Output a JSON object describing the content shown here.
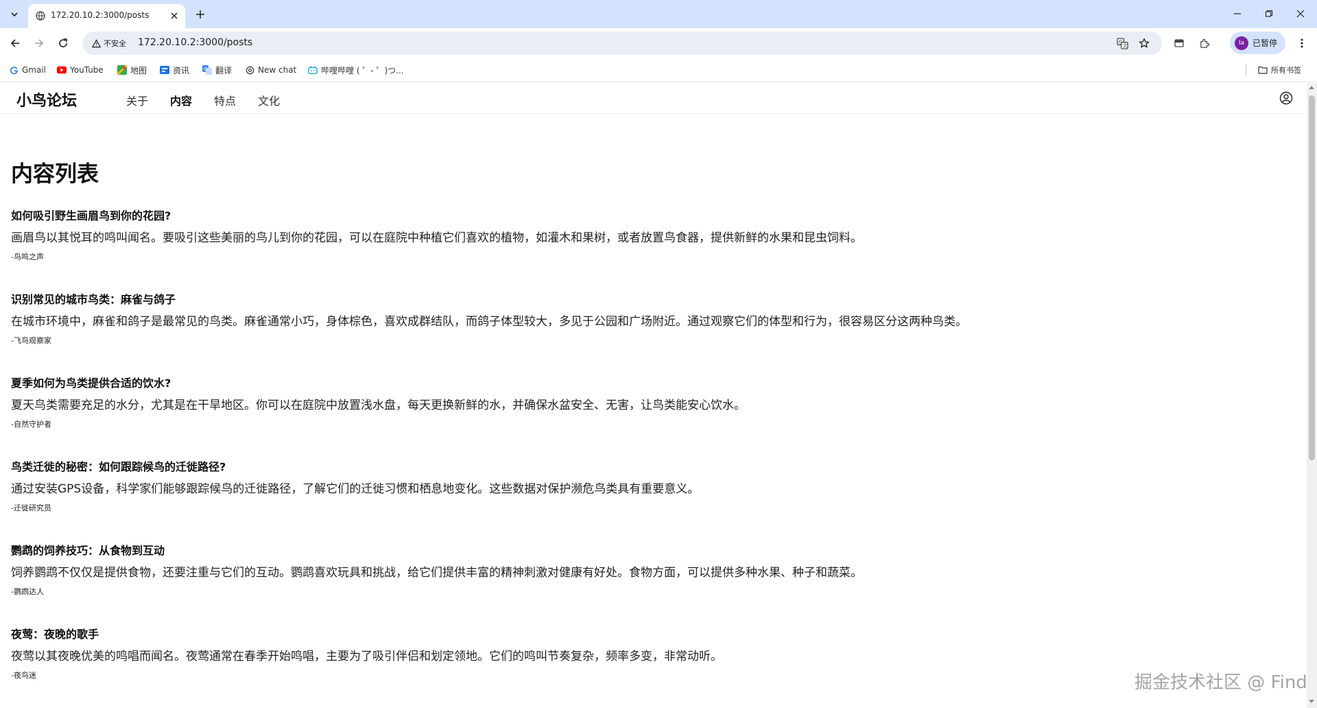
{
  "browser": {
    "tab": {
      "title": "172.20.10.2:3000/posts"
    },
    "address_bar": {
      "security_label": "不安全",
      "url": "172.20.10.2:3000/posts"
    },
    "profile": {
      "initials": "la",
      "label": "已暂停"
    },
    "bookmarks": [
      {
        "label": "Gmail",
        "icon": "gmail-icon"
      },
      {
        "label": "YouTube",
        "icon": "youtube-icon"
      },
      {
        "label": "地图",
        "icon": "maps-icon"
      },
      {
        "label": "资讯",
        "icon": "news-icon"
      },
      {
        "label": "翻译",
        "icon": "translate-icon"
      },
      {
        "label": "New chat",
        "icon": "chat-icon"
      },
      {
        "label": "哔哩哔哩 ( ゜- ゜)つ...",
        "icon": "bilibili-icon"
      }
    ],
    "all_bookmarks_label": "所有书签"
  },
  "site": {
    "brand": "小鸟论坛",
    "nav": [
      {
        "label": "关于",
        "active": false
      },
      {
        "label": "内容",
        "active": true
      },
      {
        "label": "特点",
        "active": false
      },
      {
        "label": "文化",
        "active": false
      }
    ]
  },
  "page": {
    "title": "内容列表",
    "posts": [
      {
        "title": "如何吸引野生画眉鸟到你的花园?",
        "body": "画眉鸟以其悦耳的鸣叫闻名。要吸引这些美丽的鸟儿到你的花园，可以在庭院中种植它们喜欢的植物，如灌木和果树，或者放置鸟食器，提供新鲜的水果和昆虫饲料。",
        "author": "-鸟鸣之声"
      },
      {
        "title": "识别常见的城市鸟类：麻雀与鸽子",
        "body": "在城市环境中，麻雀和鸽子是最常见的鸟类。麻雀通常小巧，身体棕色，喜欢成群结队，而鸽子体型较大，多见于公园和广场附近。通过观察它们的体型和行为，很容易区分这两种鸟类。",
        "author": "-飞鸟观察家"
      },
      {
        "title": "夏季如何为鸟类提供合适的饮水?",
        "body": "夏天鸟类需要充足的水分，尤其是在干旱地区。你可以在庭院中放置浅水盘，每天更换新鲜的水，并确保水盆安全、无害，让鸟类能安心饮水。",
        "author": "-自然守护者"
      },
      {
        "title": "鸟类迁徙的秘密：如何跟踪候鸟的迁徙路径?",
        "body": "通过安装GPS设备，科学家们能够跟踪候鸟的迁徙路径，了解它们的迁徙习惯和栖息地变化。这些数据对保护濒危鸟类具有重要意义。",
        "author": "-迁徙研究员"
      },
      {
        "title": "鹦鹉的饲养技巧：从食物到互动",
        "body": "饲养鹦鹉不仅仅是提供食物，还要注重与它们的互动。鹦鹉喜欢玩具和挑战，给它们提供丰富的精神刺激对健康有好处。食物方面，可以提供多种水果、种子和蔬菜。",
        "author": "-鹦鹉达人"
      },
      {
        "title": "夜莺：夜晚的歌手",
        "body": "夜莺以其夜晚优美的鸣唱而闻名。夜莺通常在春季开始鸣唱，主要为了吸引伴侣和划定领地。它们的鸣叫节奏复杂，频率多变，非常动听。",
        "author": "-夜鸟迷"
      }
    ]
  },
  "watermark": "掘金技术社区 @ Find",
  "colors": {
    "tabstrip": "#d3e3fd",
    "omnibox": "#e9eef6",
    "avatar": "#7b1fa2"
  }
}
